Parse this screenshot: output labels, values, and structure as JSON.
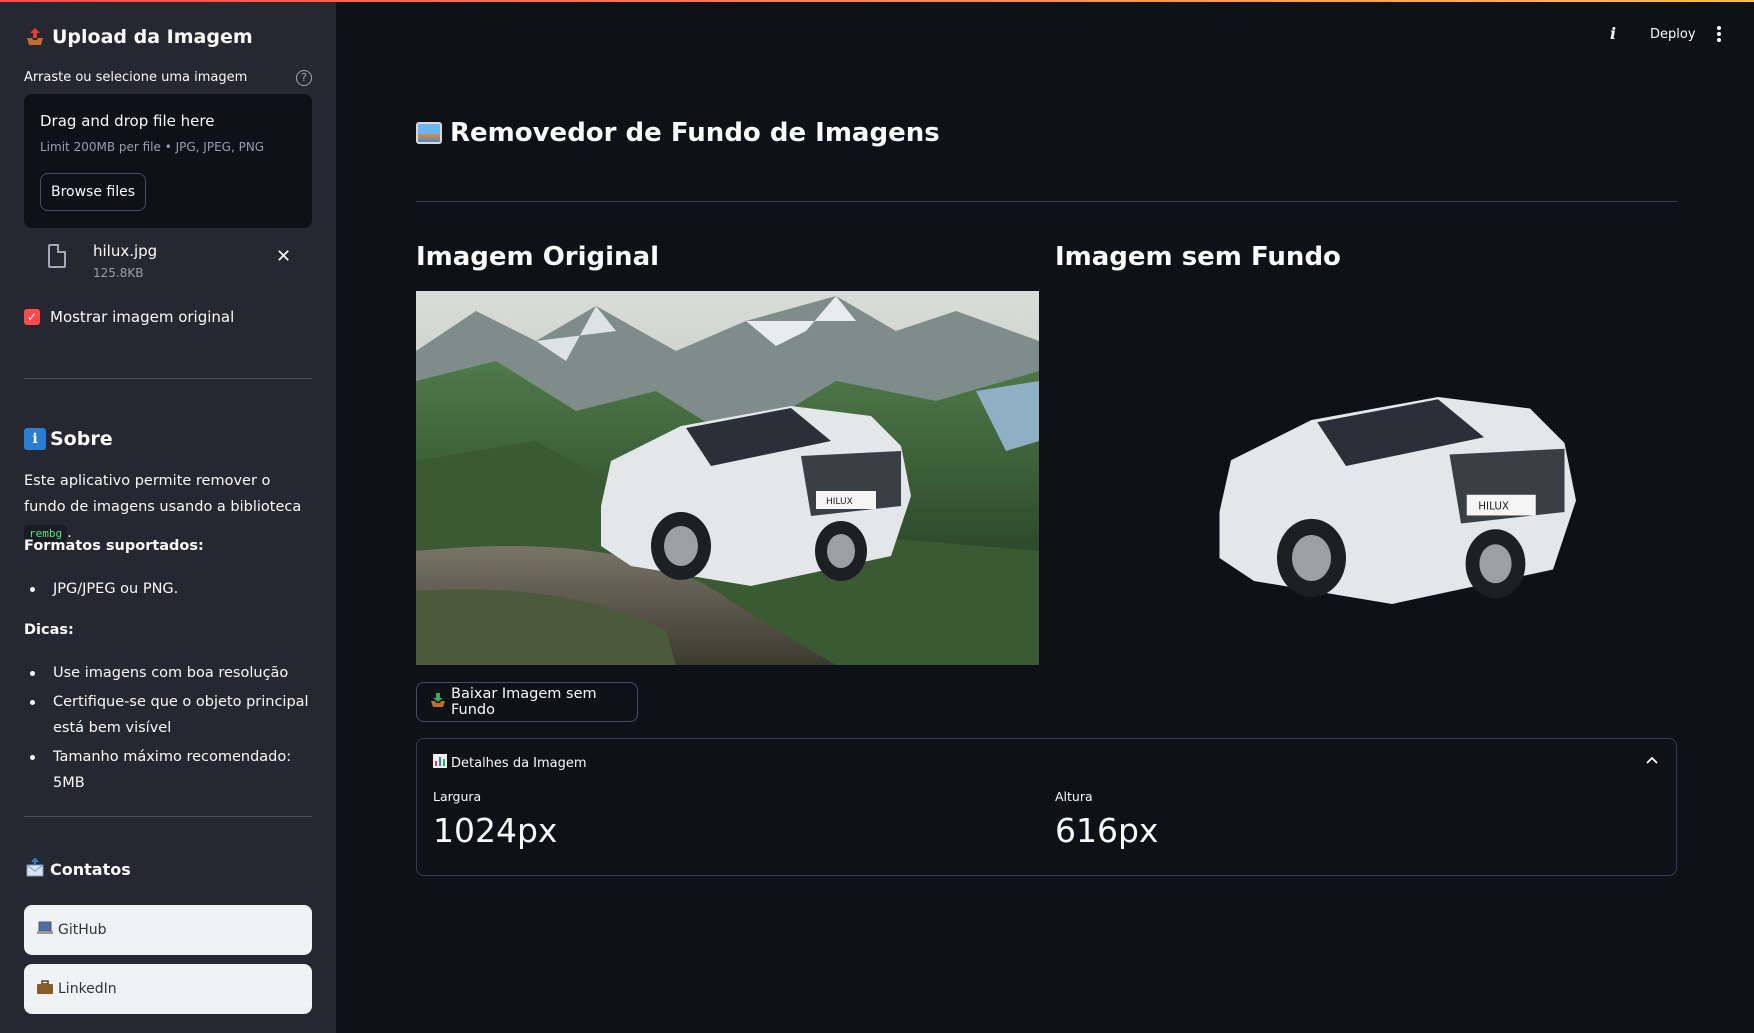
{
  "colors": {
    "background": "#0e1117",
    "sidebar": "#262730",
    "accent": "#ff4b4b",
    "code_green": "#5ce488"
  },
  "sidebar": {
    "upload_title": "Upload da Imagem",
    "upload_icon": "outbox-tray-icon",
    "uploader_label": "Arraste ou selecione uma imagem",
    "dropzone_title": "Drag and drop file here",
    "dropzone_limit": "Limit 200MB per file • JPG, JPEG, PNG",
    "browse_label": "Browse files",
    "file": {
      "name": "hilux.jpg",
      "size": "125.8KB"
    },
    "checkbox_label": "Mostrar imagem original",
    "checkbox_checked": true,
    "sobre_title": "Sobre",
    "sobre_icon": "i",
    "sobre_text_before": "Este aplicativo permite remover o fundo de imagens usando a biblioteca",
    "sobre_lib": "rembg",
    "sobre_text_after": ".",
    "formats_title": "Formatos suportados:",
    "formats": [
      "JPG/JPEG ou PNG."
    ],
    "tips_title": "Dicas:",
    "tips": [
      "Use imagens com boa resolução",
      "Certifique-se que o objeto principal está bem visível",
      "Tamanho máximo recomendado: 5MB"
    ],
    "contatos_title": "Contatos",
    "contacts": [
      {
        "icon": "laptop-icon",
        "label": "GitHub"
      },
      {
        "icon": "briefcase-icon",
        "label": "LinkedIn"
      }
    ]
  },
  "header": {
    "deploy_label": "Deploy",
    "info_icon": "i"
  },
  "main": {
    "title": "Removedor de Fundo de Imagens",
    "original_title": "Imagem Original",
    "nobg_title": "Imagem sem Fundo",
    "download_label": "Baixar Imagem sem Fundo",
    "details_title": "Detalhes da Imagem",
    "metrics": [
      {
        "label": "Largura",
        "value": "1024px"
      },
      {
        "label": "Altura",
        "value": "616px"
      }
    ]
  }
}
